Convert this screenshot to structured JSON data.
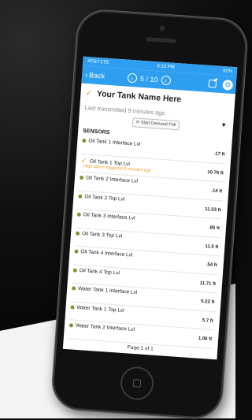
{
  "status_bar": {
    "carrier": "AT&T LTE",
    "time": "6:12 PM",
    "battery": "91%"
  },
  "nav": {
    "back_label": "Back",
    "pager": "5 / 10",
    "prev": "‹",
    "next": "›"
  },
  "tank": {
    "name": "Your Tank Name Here",
    "last_transmitted": "Last transmitted 9 minutes ago",
    "poll_button": "Start Demand Poll"
  },
  "sensors": {
    "title": "SENSORS",
    "items": [
      {
        "label": "Oil Tank 1 Interface Lvl",
        "value": ".17 ft"
      },
      {
        "label": "Oil Tank 1 Top Lvl",
        "value": "10.76 ft",
        "alarm": "High alarm triggered 9 minutes ago"
      },
      {
        "label": "Oil Tank 2 Interface Lvl",
        "value": ".14 ft"
      },
      {
        "label": "Oil Tank 2 Top Lvl",
        "value": "11.53 ft"
      },
      {
        "label": "Oil Tank 3 Interface Lvl",
        "value": ".85 ft"
      },
      {
        "label": "Oil Tank 3 Top Lvl",
        "value": "11.5 ft"
      },
      {
        "label": "Oil Tank 4 Interface Lvl",
        "value": ".54 ft"
      },
      {
        "label": "Oil Tank 4 Top Lvl",
        "value": "11.71 ft"
      },
      {
        "label": "Water Tank 1 Interface Lvl",
        "value": "5.22 ft"
      },
      {
        "label": "Water Tank 1 Top Lvl",
        "value": "5.7 ft"
      },
      {
        "label": "Water Tank 2 Interface Lvl",
        "value": "1.06 ft"
      }
    ]
  },
  "footer": {
    "page": "Page 1 of 1"
  },
  "colors": {
    "accent": "#2e9ff0",
    "alarm": "#f0a030",
    "sensor_dot": "#7a9a2e"
  }
}
